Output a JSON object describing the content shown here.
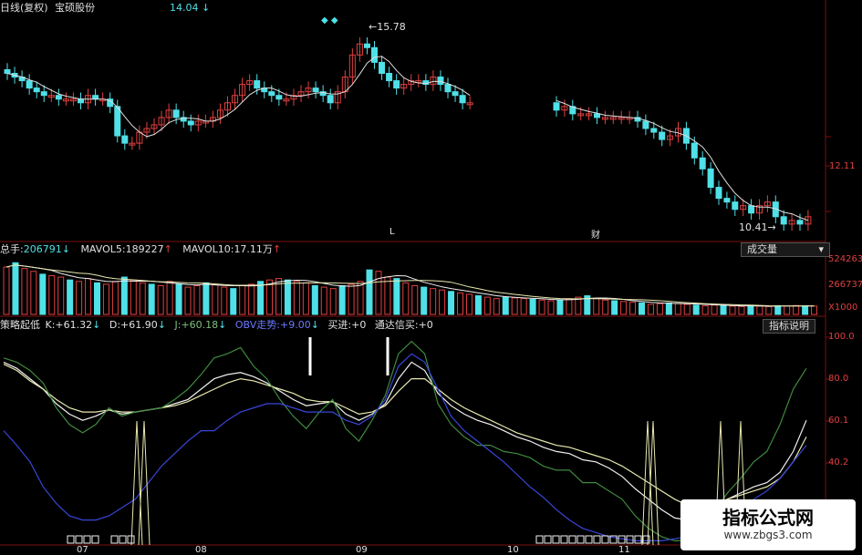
{
  "price_panel": {
    "title": "日线(复权)",
    "stock_name": "宝硕股份",
    "top_value": "14.04",
    "high_marker": "15.78",
    "low_marker": "10.41",
    "axis_label": "12.11",
    "event_L": "L",
    "event_cai": "财"
  },
  "volume_panel": {
    "total_label": "总手:",
    "total_value": "206791",
    "mavol5_label": "MAVOL5:",
    "mavol5_value": "189227",
    "mavol10_label": "MAVOL10:",
    "mavol10_value": "17.11万",
    "dropdown_label": "成交量",
    "axis_labels": [
      "524263",
      "266737",
      "X1000"
    ]
  },
  "indicator_panel": {
    "name": "策略起低",
    "k_label": "K:",
    "k_value": "+61.32",
    "d_label": "D:",
    "d_value": "+61.90",
    "j_label": "J:",
    "j_value": "+60.18",
    "obv_label": "OBV走势:",
    "obv_value": "+9.00",
    "buy_label": "买进:",
    "buy_value": "+0",
    "tdx_label": "通达信买:",
    "tdx_value": "+0",
    "explain_button": "指标说明",
    "axis_labels": [
      "100.0",
      "80.0",
      "60.1",
      "40.2"
    ]
  },
  "x_axis": [
    "07",
    "08",
    "09",
    "10",
    "11"
  ],
  "watermark": {
    "title": "指标公式网",
    "url": "www.zbgs3.com"
  },
  "colors": {
    "up": "#e04040",
    "down": "#4fe0e8",
    "k": "#f0f0f0",
    "d": "#e8e8b0",
    "j": "#3e8a3e",
    "obv": "#3846d8",
    "grid": "#7a1010"
  },
  "chart_data": [
    {
      "type": "candlestick",
      "title": "日线(复权) 宝硕股份",
      "series": [
        {
          "name": "close",
          "values": [
            14.5,
            14.4,
            14.3,
            14.1,
            14.0,
            13.9,
            13.9,
            13.8,
            13.8,
            13.8,
            13.7,
            13.9,
            13.8,
            13.8,
            13.6,
            12.8,
            12.6,
            12.6,
            12.9,
            13.0,
            13.1,
            13.3,
            13.5,
            13.3,
            13.2,
            13.1,
            13.2,
            13.2,
            13.3,
            13.5,
            13.7,
            13.9,
            14.2,
            14.3,
            14.1,
            14.0,
            13.9,
            13.8,
            13.8,
            13.9,
            14.0,
            14.1,
            14.0,
            13.9,
            13.7,
            14.0,
            14.4,
            15.0,
            15.3,
            15.2,
            14.8,
            14.5,
            14.3,
            14.1,
            14.2,
            14.3,
            14.3,
            14.2,
            14.4,
            14.2,
            14.0,
            13.9,
            13.7,
            13.7,
            13.5,
            13.6,
            13.4,
            13.4,
            13.4,
            13.3,
            13.3,
            13.3,
            13.3,
            13.3,
            13.2,
            13.0,
            12.9,
            12.7,
            12.8,
            13.0,
            12.6,
            12.2,
            11.9,
            11.4,
            11.1,
            11.0,
            10.8,
            10.9,
            10.7,
            10.9,
            11.0,
            10.6,
            10.4,
            10.5,
            10.4,
            10.6
          ]
        }
      ],
      "annotations": [
        {
          "label": "15.78",
          "type": "high"
        },
        {
          "label": "10.41",
          "type": "low"
        }
      ]
    },
    {
      "type": "bar",
      "title": "成交量",
      "series": [
        {
          "name": "总手",
          "values": [
            330,
            360,
            320,
            300,
            280,
            270,
            260,
            240,
            230,
            250,
            220,
            210,
            230,
            260,
            240,
            220,
            210,
            200,
            230,
            210,
            190,
            200,
            220,
            210,
            190,
            180,
            200,
            210,
            230,
            240,
            250,
            240,
            230,
            220,
            200,
            190,
            180,
            200,
            210,
            230,
            310,
            300,
            260,
            250,
            220,
            200,
            190,
            180,
            170,
            160,
            150,
            140,
            130,
            120,
            110,
            120,
            115,
            110,
            105,
            100,
            95,
            100,
            110,
            120,
            130,
            110,
            100,
            95,
            90,
            85,
            80,
            70,
            75,
            80,
            75,
            70,
            65,
            60,
            65,
            60,
            58,
            55,
            60,
            58,
            55,
            60,
            58,
            62,
            60,
            58
          ]
        },
        {
          "name": "MAVOL5",
          "values": [
            189.2
          ]
        },
        {
          "name": "MAVOL10",
          "values": [
            171.1
          ]
        }
      ],
      "ylabel": "X1000"
    },
    {
      "type": "line",
      "title": "策略起低",
      "ylim": [
        0,
        100
      ],
      "series": [
        {
          "name": "K",
          "values": [
            88,
            85,
            80,
            75,
            68,
            63,
            60,
            62,
            65,
            63,
            64,
            65,
            66,
            68,
            70,
            75,
            80,
            82,
            83,
            81,
            78,
            74,
            70,
            67,
            68,
            69,
            63,
            60,
            63,
            68,
            80,
            88,
            84,
            73,
            67,
            63,
            60,
            58,
            55,
            52,
            50,
            47,
            45,
            44,
            41,
            40,
            37,
            33,
            27,
            22,
            17,
            13,
            12,
            14,
            18,
            22,
            25,
            28,
            30,
            35,
            45,
            60
          ]
        },
        {
          "name": "D",
          "values": [
            87,
            84,
            79,
            75,
            70,
            66,
            64,
            64,
            65,
            64,
            64,
            65,
            66,
            67,
            69,
            72,
            75,
            78,
            80,
            79,
            77,
            75,
            73,
            70,
            69,
            69,
            66,
            63,
            64,
            67,
            74,
            80,
            80,
            75,
            70,
            66,
            63,
            60,
            57,
            54,
            52,
            50,
            48,
            47,
            45,
            43,
            41,
            38,
            34,
            30,
            26,
            22,
            19,
            19,
            20,
            22,
            24,
            26,
            28,
            32,
            40,
            52
          ]
        },
        {
          "name": "J",
          "values": [
            90,
            88,
            84,
            78,
            66,
            58,
            54,
            58,
            66,
            62,
            64,
            65,
            66,
            70,
            75,
            82,
            90,
            92,
            95,
            86,
            80,
            70,
            62,
            56,
            64,
            70,
            56,
            50,
            60,
            72,
            92,
            98,
            92,
            68,
            58,
            52,
            48,
            48,
            45,
            44,
            42,
            38,
            36,
            36,
            30,
            30,
            26,
            22,
            14,
            8,
            4,
            2,
            2,
            8,
            16,
            25,
            32,
            40,
            45,
            58,
            75,
            85
          ]
        },
        {
          "name": "OBV走势",
          "values": [
            55,
            48,
            40,
            28,
            20,
            14,
            12,
            12,
            14,
            18,
            22,
            30,
            38,
            44,
            50,
            55,
            55,
            60,
            64,
            66,
            68,
            68,
            66,
            64,
            64,
            64,
            60,
            58,
            62,
            70,
            86,
            92,
            88,
            75,
            62,
            55,
            50,
            45,
            40,
            34,
            28,
            23,
            17,
            12,
            8,
            6,
            4,
            3,
            2,
            2,
            2,
            3,
            4,
            4,
            6,
            10,
            16,
            22,
            26,
            32,
            40,
            48
          ]
        }
      ],
      "axis_ticks": [
        "100.0",
        "80.0",
        "60.1",
        "40.2"
      ]
    }
  ]
}
